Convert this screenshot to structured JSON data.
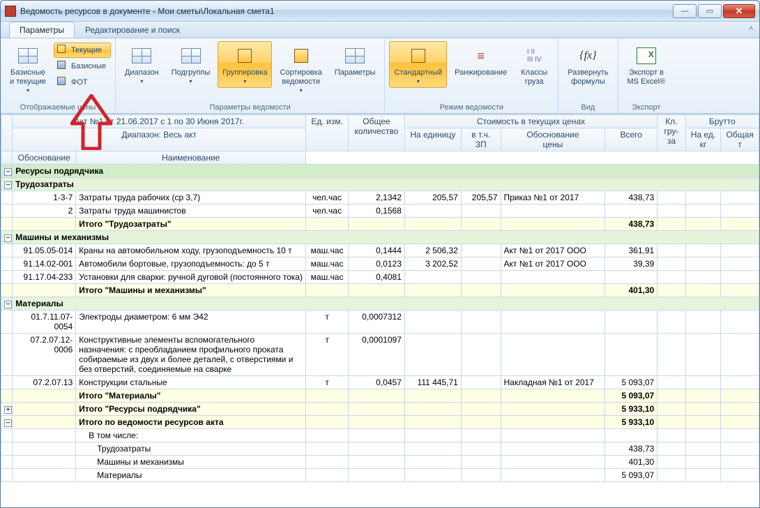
{
  "window": {
    "title": "Ведомость ресурсов в документе - Мои сметы\\Локальная смета1"
  },
  "tabs": {
    "t0": "Параметры",
    "t1": "Редактирование и поиск"
  },
  "ribbon": {
    "g1": {
      "btn1": "Базисные\nи текущие",
      "s1": "Текущие",
      "s2": "Базисные",
      "s3": "ФОТ",
      "label": "Отображаемые цены"
    },
    "g2": {
      "b1": "Диапазон",
      "b2": "Подгруппы",
      "b3": "Группировка",
      "b4": "Сортировка\nведомости",
      "b5": "Параметры",
      "label": "Параметры ведомости"
    },
    "g3": {
      "b1": "Стандартный",
      "b2": "Ранжирование",
      "b3": "Классы\nгруза",
      "label": "Режим ведомости"
    },
    "g4": {
      "b1": "Развернуть\nформулы",
      "label": "Вид"
    },
    "g5": {
      "b1": "Экспорт в\nMS Excel®",
      "label": "Экспорт"
    }
  },
  "hdr": {
    "info1": "Акт №1 от 21.06.2017 с 1 по 30 Июня 2017г.",
    "info2": "Диапазон: Весь акт",
    "c_obosn": "Обоснование",
    "c_naim": "Наименование",
    "c_ed": "Ед. изм.",
    "c_qty": "Общее\nколичество",
    "c_cost": "Стоимость в текущих ценах",
    "c_unit": "На единицу",
    "c_zp": "в т.ч.\nЗП",
    "c_obc": "Обоснование\nцены",
    "c_tot": "Всего",
    "c_kl": "Кл.\nгру-\nза",
    "c_br": "Брутто",
    "c_bre": "На ед.\nкг",
    "c_brt": "Общая\nт"
  },
  "rows": {
    "g1": "Ресурсы подрядчика",
    "g2a": "Трудозатраты",
    "r1": {
      "ob": "1-3-7",
      "nm": "Затраты труда рабочих (ср 3,7)",
      "ed": "чел.час",
      "q": "2,1342",
      "u": "205,57",
      "zp": "205,57",
      "oc": "Приказ №1 от 2017",
      "t": "438,73"
    },
    "r2": {
      "ob": "2",
      "nm": "Затраты труда машинистов",
      "ed": "чел.час",
      "q": "0,1568"
    },
    "it2a": {
      "lbl": "Итого \"Трудозатраты\"",
      "t": "438,73"
    },
    "g2b": "Машины и механизмы",
    "r3": {
      "ob": "91.05.05-014",
      "nm": "Краны на автомобильном ходу, грузоподъемность 10 т",
      "ed": "маш.час",
      "q": "0,1444",
      "u": "2 506,32",
      "oc": "Акт №1 от 2017 ООО",
      "t": "361,91"
    },
    "r4": {
      "ob": "91.14.02-001",
      "nm": "Автомобили бортовые, грузоподъемность: до 5 т",
      "ed": "маш.час",
      "q": "0,0123",
      "u": "3 202,52",
      "oc": "Акт №1 от 2017 ООО",
      "t": "39,39"
    },
    "r5": {
      "ob": "91.17.04-233",
      "nm": "Установки для сварки: ручной дуговой (постоянного тока)",
      "ed": "маш.час",
      "q": "0,4081"
    },
    "it2b": {
      "lbl": "Итого \"Машины и механизмы\"",
      "t": "401,30"
    },
    "g2c": "Материалы",
    "r6": {
      "ob": "01.7.11.07-0054",
      "nm": "Электроды диаметром: 6 мм Э42",
      "ed": "т",
      "q": "0,0007312"
    },
    "r7": {
      "ob": "07.2.07.12-0006",
      "nm": "Конструктивные элементы вспомогательного назначения: с преобладанием профильного проката собираемые из двух и более деталей, с отверстиями и без отверстий, соединяемые на сварке",
      "ed": "т",
      "q": "0,0001097"
    },
    "r8": {
      "ob": "07.2.07.13",
      "nm": "Конструкции стальные",
      "ed": "т",
      "q": "0,0457",
      "u": "111 445,71",
      "oc": "Накладная №1 от 2017",
      "t": "5 093,07"
    },
    "it2c": {
      "lbl": "Итого \"Материалы\"",
      "t": "5 093,07"
    },
    "it1": {
      "lbl": "Итого \"Ресурсы подрядчика\"",
      "t": "5 933,10"
    },
    "it0": {
      "lbl": "Итого по ведомости ресурсов акта",
      "t": "5 933,10"
    },
    "sub": "В том числе:",
    "s1": {
      "lbl": "Трудозатраты",
      "t": "438,73"
    },
    "s2": {
      "lbl": "Машины и механизмы",
      "t": "401,30"
    },
    "s3": {
      "lbl": "Материалы",
      "t": "5 093,07"
    }
  }
}
